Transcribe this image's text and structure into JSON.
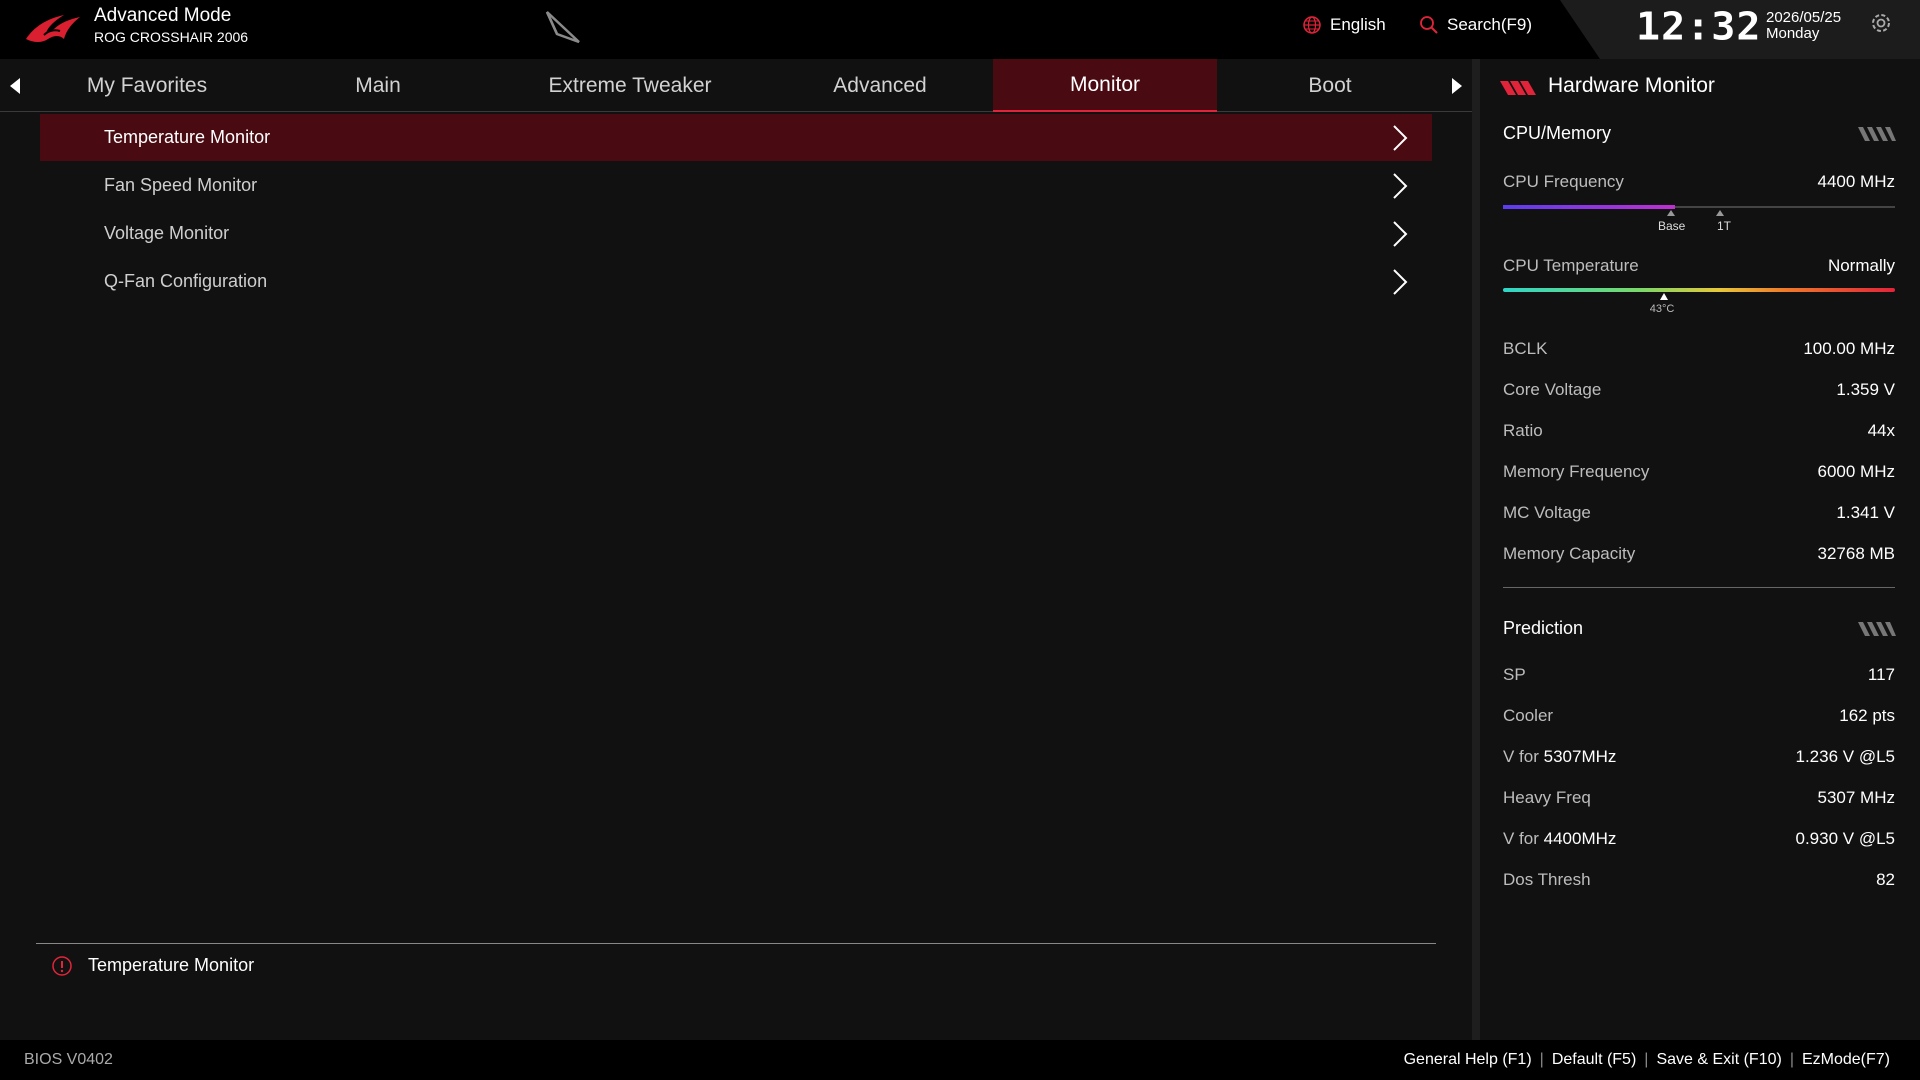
{
  "header": {
    "mode": "Advanced Mode",
    "board": "ROG CROSSHAIR 2006",
    "language": "English",
    "search": "Search(F9)",
    "time": "12:32",
    "date": "2026/05/25",
    "weekday": "Monday"
  },
  "tabs": [
    "My Favorites",
    "Main",
    "Extreme Tweaker",
    "Advanced",
    "Monitor",
    "Boot"
  ],
  "active_tab": "Monitor",
  "menu": [
    {
      "label": "Temperature Monitor"
    },
    {
      "label": "Fan Speed Monitor"
    },
    {
      "label": "Voltage Monitor"
    },
    {
      "label": "Q-Fan Configuration"
    }
  ],
  "help_text": "Temperature Monitor",
  "hw_monitor": {
    "title": "Hardware Monitor",
    "cpu_section": "CPU/Memory",
    "cpu_freq": {
      "label": "CPU Frequency",
      "value": "4400 MHz",
      "fill_fraction": 0.44
    },
    "freq_markers": [
      "Base",
      "1T"
    ],
    "cpu_temp": {
      "label": "CPU Temperature",
      "value": "Normally",
      "marker": "43°C",
      "level_fraction": 0.41
    },
    "cpu_rows": [
      {
        "label": "BCLK",
        "value": "100.00 MHz"
      },
      {
        "label": "Core Voltage",
        "value": "1.359 V"
      },
      {
        "label": "Ratio",
        "value": "44x"
      },
      {
        "label": "Memory Frequency",
        "value": "6000 MHz"
      },
      {
        "label": "MC Voltage",
        "value": "1.341 V"
      },
      {
        "label": "Memory Capacity",
        "value": "32768 MB"
      }
    ],
    "prediction_section": "Prediction",
    "prediction_rows": [
      {
        "label_pre": "SP",
        "label_em": "",
        "value": "117"
      },
      {
        "label_pre": "Cooler",
        "label_em": "",
        "value": "162 pts"
      },
      {
        "label_pre": "V for ",
        "label_em": "5307MHz",
        "value": "1.236 V @L5"
      },
      {
        "label_pre": "Heavy Freq",
        "label_em": "",
        "value": "5307 MHz"
      },
      {
        "label_pre": "V for ",
        "label_em": "4400MHz",
        "value": "0.930 V @L5"
      },
      {
        "label_pre": "Dos Thresh",
        "label_em": "",
        "value": "82"
      }
    ]
  },
  "footer": {
    "bios": "BIOS V0402",
    "links": [
      "General Help (F1)",
      "Default (F5)",
      "Save & Exit (F10)",
      "EzMode(F7)"
    ]
  },
  "colors": {
    "accent": "#e2243a",
    "selected_bg": "#4a0a12",
    "freq_bar_start": "#5a3df0",
    "freq_bar_end": "#c02fd0"
  }
}
